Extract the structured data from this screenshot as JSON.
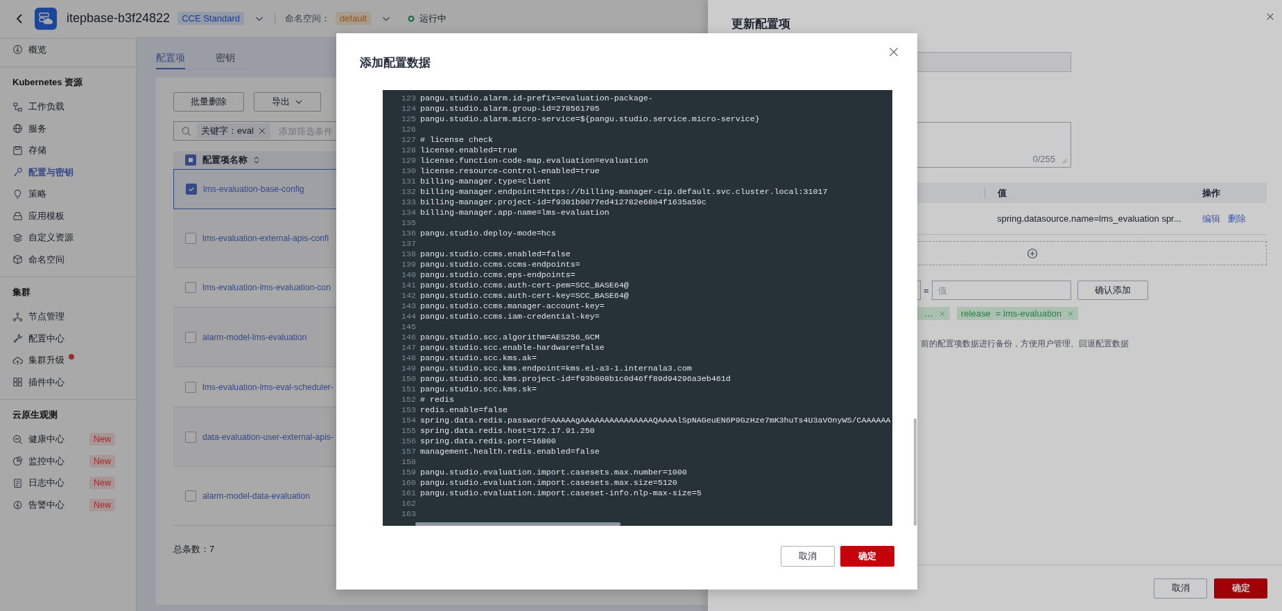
{
  "header": {
    "title": "itepbase-b3f24822",
    "edition": "CCE Standard",
    "namespace_label": "命名空间：",
    "namespace": "default",
    "status": "运行中"
  },
  "sidebar": {
    "groups": [
      {
        "items": [
          {
            "label": "概览",
            "selected": false,
            "notice": false
          }
        ]
      },
      {
        "heading": "Kubernetes 资源",
        "items": [
          {
            "label": "工作负载",
            "selected": false,
            "notice": false
          },
          {
            "label": "服务",
            "selected": false,
            "notice": false
          },
          {
            "label": "存储",
            "selected": false,
            "notice": false
          },
          {
            "label": "配置与密钥",
            "selected": true,
            "notice": false
          },
          {
            "label": "策略",
            "selected": false,
            "notice": false
          },
          {
            "label": "应用模板",
            "selected": false,
            "notice": false
          },
          {
            "label": "自定义资源",
            "selected": false,
            "notice": false
          },
          {
            "label": "命名空间",
            "selected": false,
            "notice": false
          }
        ]
      },
      {
        "heading": "集群",
        "items": [
          {
            "label": "节点管理",
            "selected": false,
            "notice": false
          },
          {
            "label": "配置中心",
            "selected": false,
            "notice": false
          },
          {
            "label": "集群升级",
            "selected": false,
            "notice": true
          },
          {
            "label": "插件中心",
            "selected": false,
            "notice": false
          }
        ]
      },
      {
        "heading": "云原生观测",
        "items": [
          {
            "label": "健康中心",
            "selected": false,
            "badge": "New"
          },
          {
            "label": "监控中心",
            "selected": false,
            "badge": "New"
          },
          {
            "label": "日志中心",
            "selected": false,
            "badge": "New"
          },
          {
            "label": "告警中心",
            "selected": false,
            "badge": "New"
          }
        ]
      }
    ]
  },
  "tabs": [
    {
      "label": "配置项",
      "selected": true
    },
    {
      "label": "密钥",
      "selected": false
    }
  ],
  "toolbar": [
    {
      "label": "批量删除",
      "kind": "plain"
    },
    {
      "label": "导出",
      "kind": "dropdown"
    }
  ],
  "filter": {
    "chip": "关键字：eval",
    "placeholder": "添加筛选条件"
  },
  "table": {
    "header_indeterminate": true,
    "column": "配置项名称",
    "rows": [
      {
        "name": "lms-evaluation-base-config",
        "checked": true
      },
      {
        "name": "lms-evaluation-external-apis-confi",
        "checked": false
      },
      {
        "name": "lms-evaluation-lms-evaluation-con",
        "checked": false
      },
      {
        "name": "alarm-model-lms-evaluation",
        "checked": false
      },
      {
        "name": "lms-evaluation-lms-eval-scheduler-",
        "checked": false
      },
      {
        "name": "data-evaluation-user-external-apis-",
        "checked": false
      },
      {
        "name": "alarm-model-data-evaluation",
        "checked": false
      }
    ]
  },
  "total": "总条数：7",
  "drawer": {
    "title": "更新配置项",
    "counter": "0/255",
    "data_table": {
      "columns": [
        "值",
        "操作"
      ],
      "rows": [
        {
          "value": "spring.datasource.name=lms_evaluation spr...",
          "actions": [
            "编辑",
            "删除"
          ]
        }
      ]
    },
    "equals": "=",
    "value_placeholder": "值",
    "add_button": "确认添加",
    "tags": [
      {
        "text": "…"
      },
      {
        "text": "release  = lms-evaluation"
      }
    ],
    "note": "前的配置项数据进行备份，方便用户管理、回退配置数据",
    "buttons": [
      {
        "label": "取消",
        "kind": "secondary"
      },
      {
        "label": "确定",
        "kind": "primary"
      }
    ]
  },
  "modal": {
    "title": "添加配置数据",
    "lines": [
      {
        "no": "123",
        "text": "pangu.studio.alarm.id-prefix=evaluation-package-"
      },
      {
        "no": "124",
        "text": "pangu.studio.alarm.group-id=278561705"
      },
      {
        "no": "125",
        "text": "pangu.studio.alarm.micro-service=${pangu.studio.service.micro-service}"
      },
      {
        "no": "126"
      },
      {
        "no": "127",
        "text": "# license check"
      },
      {
        "no": "128",
        "text": "license.enabled=true"
      },
      {
        "no": "129",
        "text": "license.function-code-map.evaluation=evaluation"
      },
      {
        "no": "130",
        "text": "license.resource-control-enabled=true"
      },
      {
        "no": "131",
        "text": "billing-manager.type=client"
      },
      {
        "no": "132",
        "text": "billing-manager.endpoint=https://billing-manager-cip.default.svc.cluster.local:31017"
      },
      {
        "no": "133",
        "text": "billing-manager.project-id=f9301b0077ed412782e6804f1635a59c"
      },
      {
        "no": "134",
        "text": "billing-manager.app-name=lms-evaluation"
      },
      {
        "no": "135"
      },
      {
        "no": "136",
        "text": "pangu.studio.deploy-mode=hcs"
      },
      {
        "no": "137"
      },
      {
        "no": "138",
        "text": "pangu.studio.ccms.enabled=false"
      },
      {
        "no": "139",
        "text": "pangu.studio.ccms.ccms-endpoints="
      },
      {
        "no": "140",
        "text": "pangu.studio.ccms.eps-endpoints="
      },
      {
        "no": "141",
        "text": "pangu.studio.ccms.auth-cert-pem=SCC_BASE64@"
      },
      {
        "no": "142",
        "text": "pangu.studio.ccms.auth-cert-key=SCC_BASE64@"
      },
      {
        "no": "143",
        "text": "pangu.studio.ccms.manager-account-key="
      },
      {
        "no": "144",
        "text": "pangu.studio.ccms.iam-credential-key="
      },
      {
        "no": "145"
      },
      {
        "no": "146",
        "text": "pangu.studio.scc.algorithm=AES256_GCM"
      },
      {
        "no": "147",
        "text": "pangu.studio.scc.enable-hardware=false"
      },
      {
        "no": "148",
        "text": "pangu.studio.scc.kms.ak="
      },
      {
        "no": "149",
        "text": "pangu.studio.scc.kms.endpoint=kms.ei-a3-1.internala3.com"
      },
      {
        "no": "150",
        "text": "pangu.studio.scc.kms.project-id=f93b008b1c0d46ff89d94296a3eb461d"
      },
      {
        "no": "151",
        "text": "pangu.studio.scc.kms.sk="
      },
      {
        "no": "152",
        "text": "# redis"
      },
      {
        "no": "153",
        "text": "redis.enable=false"
      },
      {
        "no": "154",
        "text": "spring.data.redis.password=AAAAAgAAAAAAAAAAAAAAAQAAAAlSpNAGeuEN6P9GzHze7mK3huTs4U3aVOnyWS/CAAAAAA"
      },
      {
        "no": "155",
        "text": "spring.data.redis.host=172.17.91.250"
      },
      {
        "no": "156",
        "text": "spring.data.redis.port=16800"
      },
      {
        "no": "157",
        "text": "management.health.redis.enabled=false"
      },
      {
        "no": "158"
      },
      {
        "no": "159",
        "text": "pangu.studio.evaluation.import.casesets.max.number=1000"
      },
      {
        "no": "160",
        "text": "pangu.studio.evaluation.import.casesets.max.size=5120"
      },
      {
        "no": "161",
        "text": "pangu.studio.evaluation.import.caseset-info.nlp-max-size=5"
      },
      {
        "no": "162"
      },
      {
        "no": "163"
      }
    ],
    "buttons": [
      {
        "label": "取消",
        "kind": "secondary"
      },
      {
        "label": "确定",
        "kind": "primary"
      }
    ]
  }
}
